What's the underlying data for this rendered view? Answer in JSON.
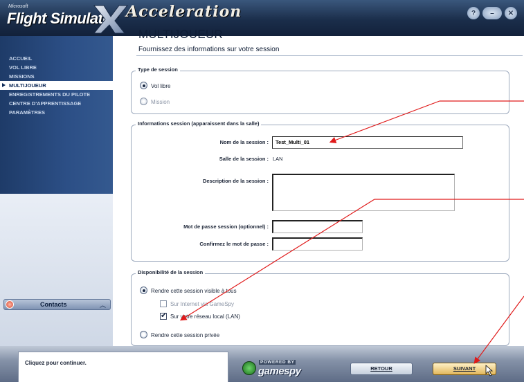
{
  "header": {
    "brand_small": "Microsoft",
    "brand_title": "Flight Simulator",
    "brand_x": "X",
    "edition": "Acceleration"
  },
  "nav": {
    "items": [
      {
        "label": "ACCUEIL",
        "active": false
      },
      {
        "label": "VOL LIBRE",
        "active": false
      },
      {
        "label": "MISSIONS",
        "active": false
      },
      {
        "label": "MULTIJOUEUR",
        "active": true
      },
      {
        "label": "ENREGISTREMENTS DU PILOTE",
        "active": false
      },
      {
        "label": "CENTRE D'APPRENTISSAGE",
        "active": false
      },
      {
        "label": "PARAMÈTRES",
        "active": false
      }
    ],
    "contacts_label": "Contacts"
  },
  "main": {
    "title": "MULTIJOUEUR",
    "subtitle": "Fournissez des informations sur votre session",
    "session_type": {
      "legend": "Type de session",
      "options": [
        {
          "label": "Vol libre",
          "checked": true,
          "disabled": false
        },
        {
          "label": "Mission",
          "checked": false,
          "disabled": true
        }
      ]
    },
    "session_info": {
      "legend": "Informations session (apparaissent dans la salle)",
      "name_label": "Nom de la session :",
      "name_value": "Test_Multi_01",
      "room_label": "Salle de la session :",
      "room_value": "LAN",
      "description_label": "Description de la session :",
      "description_value": "",
      "password_label": "Mot de passe session (optionnel) :",
      "password_value": "",
      "confirm_label": "Confirmez le mot de passe :",
      "confirm_value": ""
    },
    "availability": {
      "legend": "Disponibilité de la session",
      "visible_label": "Rendre cette session visible à tous",
      "visible_checked": true,
      "internet_label": "Sur Internet via GameSpy",
      "internet_checked": false,
      "lan_label": "Sur votre réseau local (LAN)",
      "lan_checked": true,
      "private_label": "Rendre cette session privée",
      "private_checked": false
    }
  },
  "footer": {
    "status_text": "Cliquez pour continuer.",
    "powered_by": "POWERED BY",
    "gamespy": "gamespy",
    "back_label": "RETOUR",
    "next_label": "SUIVANT"
  },
  "colors": {
    "nav_bg": "#2c4f86",
    "accent_arrow": "#e01a1a",
    "next_button": "#e2b75c"
  }
}
